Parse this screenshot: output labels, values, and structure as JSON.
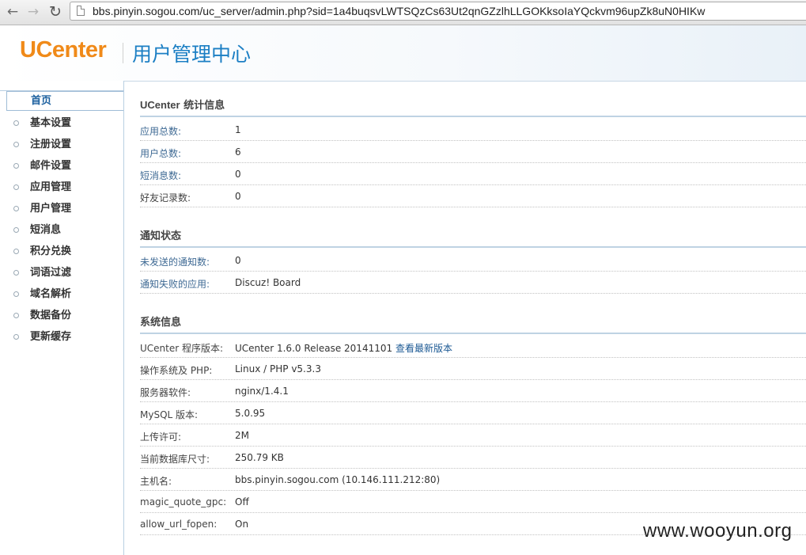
{
  "browser": {
    "url": "bbs.pinyin.sogou.com/uc_server/admin.php?sid=1a4buqsvLWTSQzCs63Ut2qnGZzlhLLGOKksoIaYQckvm96upZk8uN0HIKw",
    "back_icon": "arrow-left-icon",
    "forward_icon": "arrow-right-icon",
    "reload_icon": "reload-icon"
  },
  "header": {
    "logo": "UCenter",
    "title": "用户管理中心"
  },
  "sidebar": {
    "items": [
      {
        "label": "首页"
      },
      {
        "label": "基本设置"
      },
      {
        "label": "注册设置"
      },
      {
        "label": "邮件设置"
      },
      {
        "label": "应用管理"
      },
      {
        "label": "用户管理"
      },
      {
        "label": "短消息"
      },
      {
        "label": "积分兑换"
      },
      {
        "label": "词语过滤"
      },
      {
        "label": "域名解析"
      },
      {
        "label": "数据备份"
      },
      {
        "label": "更新缓存"
      }
    ]
  },
  "stats": {
    "title_latin": "UCenter",
    "title_cn": " 统计信息",
    "rows": [
      {
        "label": "应用总数:",
        "value": "1"
      },
      {
        "label": "用户总数:",
        "value": "6"
      },
      {
        "label": "短消息数:",
        "value": "0"
      },
      {
        "label": "好友记录数:",
        "value": "0"
      }
    ]
  },
  "notify": {
    "title": "通知状态",
    "rows": [
      {
        "label": "未发送的通知数:",
        "value": "0"
      },
      {
        "label": "通知失败的应用:",
        "value": "Discuz! Board"
      }
    ]
  },
  "system": {
    "title": "系统信息",
    "rows": [
      {
        "label": "UCenter 程序版本:",
        "value": "UCenter 1.6.0 Release 20141101",
        "link": "查看最新版本"
      },
      {
        "label": "操作系统及 PHP:",
        "value": "Linux / PHP v5.3.3"
      },
      {
        "label": "服务器软件:",
        "value": "nginx/1.4.1"
      },
      {
        "label": "MySQL 版本:",
        "value": "5.0.95"
      },
      {
        "label": "上传许可:",
        "value": "2M"
      },
      {
        "label": "当前数据库尺寸:",
        "value": "250.79 KB"
      },
      {
        "label": "主机名:",
        "value": "bbs.pinyin.sogou.com (10.146.111.212:80)"
      },
      {
        "label": "magic_quote_gpc:",
        "value": "Off"
      },
      {
        "label": "allow_url_fopen:",
        "value": "On"
      }
    ]
  },
  "watermark": "www.wooyun.org"
}
